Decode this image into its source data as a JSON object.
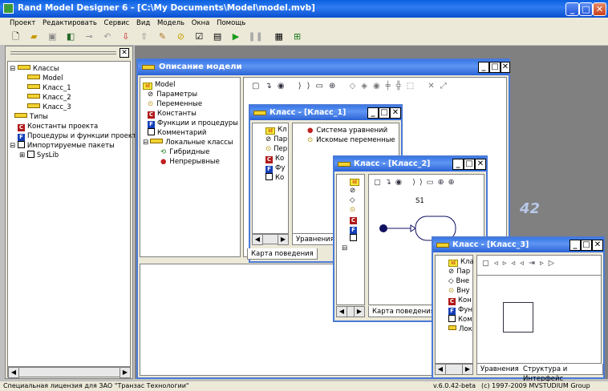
{
  "app": {
    "title": "Rand Model Designer 6 - [C:\\My Documents\\Model\\model.mvb]",
    "menu": [
      "Проект",
      "Редактировать",
      "Сервис",
      "Вид",
      "Модель",
      "Окна",
      "Помощь"
    ]
  },
  "left_tree": {
    "items": [
      {
        "label": "Классы",
        "level": 0,
        "icon": "folder-icon"
      },
      {
        "label": "Model",
        "level": 1,
        "icon": "class-icon"
      },
      {
        "label": "Класс_1",
        "level": 1,
        "icon": "class-icon"
      },
      {
        "label": "Класс_2",
        "level": 1,
        "icon": "class-icon"
      },
      {
        "label": "Класс_3",
        "level": 1,
        "icon": "class-icon"
      },
      {
        "label": "Типы",
        "level": 0,
        "icon": "folder-icon"
      },
      {
        "label": "Константы проекта",
        "level": 0,
        "icon": "constant-icon"
      },
      {
        "label": "Процедуры и функции проект",
        "level": 0,
        "icon": "function-icon"
      },
      {
        "label": "Импортируемые пакеты",
        "level": 0,
        "icon": "package-icon"
      },
      {
        "label": "SysLib",
        "level": 1,
        "icon": "package-icon"
      }
    ]
  },
  "model_window": {
    "title": "Описание модели",
    "tree": [
      {
        "label": "Model",
        "icon": "id-icon"
      },
      {
        "label": "Параметры",
        "icon": "parameter-icon"
      },
      {
        "label": "Переменные",
        "icon": "variable-icon"
      },
      {
        "label": "Константы",
        "icon": "constant-icon"
      },
      {
        "label": "Функции и процедуры",
        "icon": "function-icon"
      },
      {
        "label": "Комментарий",
        "icon": "comment-icon"
      },
      {
        "label": "Локальные классы",
        "icon": "folder-icon"
      },
      {
        "label": "Гибридные",
        "icon": "hybrid-icon"
      },
      {
        "label": "Непрерывные",
        "icon": "continuous-icon"
      }
    ]
  },
  "class1_window": {
    "title": "Класс - [Класс_1]",
    "tree": [
      "Кл",
      "Пар",
      "Пер",
      "Ко",
      "Фу",
      "Ко"
    ],
    "equations": [
      "Система уравнений",
      "Искомые переменные"
    ],
    "tab_equations": "Уравнения",
    "tab_behavior": "Карта поведения"
  },
  "class2_window": {
    "title": "Класс - [Класс_2]",
    "state_label": "S1",
    "tab_behavior": "Карта поведения"
  },
  "class3_window": {
    "title": "Класс - [Класс_3]",
    "tree": [
      "Кла",
      "Пар",
      "Вне",
      "Вну",
      "Кон",
      "Фун",
      "Ком",
      "Лок"
    ],
    "tab_equations": "Уравнения",
    "tab_structure": "Структура и Интерфейс"
  },
  "watermark": "42",
  "status": {
    "license": "Специальная лицензия для ЗАО \"Транзас Технологии\"",
    "version": "v.6.0.42-beta",
    "copyright": "(c) 1997-2009 MVSTUDIUM Group"
  }
}
